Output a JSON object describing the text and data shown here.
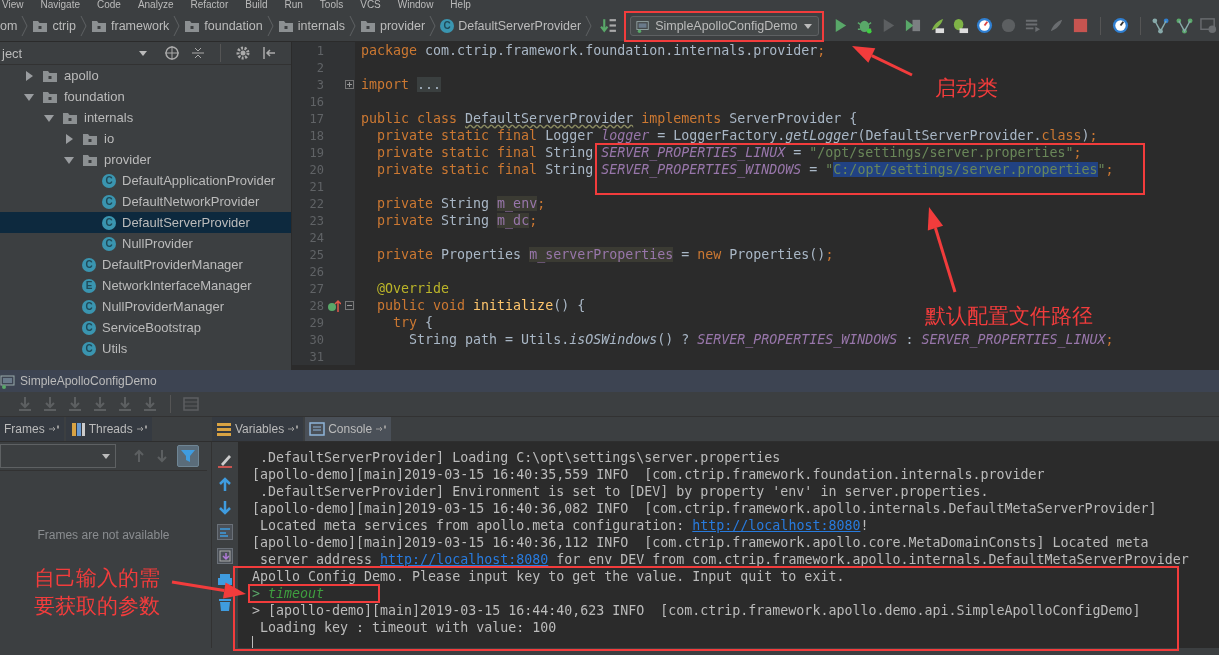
{
  "menu": [
    "View",
    "Navigate",
    "Code",
    "Analyze",
    "Refactor",
    "Build",
    "Run",
    "Tools",
    "VCS",
    "Window",
    "Help"
  ],
  "breadcrumbs": [
    {
      "text": "om",
      "kind": "fragment"
    },
    {
      "text": "ctrip",
      "kind": "folder"
    },
    {
      "text": "framework",
      "kind": "folder"
    },
    {
      "text": "foundation",
      "kind": "folder"
    },
    {
      "text": "internals",
      "kind": "folder"
    },
    {
      "text": "provider",
      "kind": "folder"
    },
    {
      "text": "DefaultServerProvider",
      "kind": "class",
      "badge": "C"
    }
  ],
  "run_config": {
    "label": "SimpleApolloConfigDemo"
  },
  "project_panel": {
    "title": "ject",
    "tree": [
      {
        "label": "apollo",
        "kind": "folder",
        "expanded": false,
        "selected": false
      },
      {
        "label": "foundation",
        "kind": "folder",
        "expanded": true,
        "selected": false,
        "children": [
          {
            "label": "internals",
            "kind": "folder",
            "expanded": true,
            "selected": false,
            "children": [
              {
                "label": "io",
                "kind": "folder",
                "expanded": false,
                "selected": false
              },
              {
                "label": "provider",
                "kind": "folder",
                "expanded": true,
                "selected": false,
                "children": [
                  {
                    "label": "DefaultApplicationProvider",
                    "kind": "class",
                    "badge": "C",
                    "selected": false
                  },
                  {
                    "label": "DefaultNetworkProvider",
                    "kind": "class",
                    "badge": "C",
                    "selected": false
                  },
                  {
                    "label": "DefaultServerProvider",
                    "kind": "class",
                    "badge": "C",
                    "selected": true
                  },
                  {
                    "label": "NullProvider",
                    "kind": "class",
                    "badge": "C",
                    "selected": false
                  }
                ]
              },
              {
                "label": "DefaultProviderManager",
                "kind": "class",
                "badge": "C",
                "selected": false
              },
              {
                "label": "NetworkInterfaceManager",
                "kind": "class",
                "badge": "E",
                "selected": false
              },
              {
                "label": "NullProviderManager",
                "kind": "class",
                "badge": "C",
                "selected": false
              },
              {
                "label": "ServiceBootstrap",
                "kind": "class",
                "badge": "C",
                "selected": false
              },
              {
                "label": "Utils",
                "kind": "class",
                "badge": "C",
                "selected": false
              }
            ]
          }
        ]
      }
    ]
  },
  "editor": {
    "lines": [
      {
        "number": "1",
        "segments": [
          {
            "text": "package",
            "kind": "kw"
          },
          {
            "text": " com.ctrip.framework.foundation.internals.provider",
            "kind": "plain"
          },
          {
            "text": ";",
            "kind": "kw"
          }
        ]
      },
      {
        "number": "2"
      },
      {
        "number": "3",
        "collapsed": true,
        "segments": [
          {
            "text": "import ",
            "kind": "kw"
          },
          {
            "text": "...",
            "kind": "folded"
          }
        ]
      },
      {
        "number": "16"
      },
      {
        "number": "17",
        "segments": [
          {
            "text": "public class ",
            "kind": "kw"
          },
          {
            "text": "DefaultServerProvider",
            "kind": "squiggle"
          },
          {
            "text": " implements ",
            "kind": "kw"
          },
          {
            "text": "ServerProvider {",
            "kind": "plain"
          }
        ]
      },
      {
        "number": "18",
        "segments": [
          {
            "text": "  private static final ",
            "kind": "kw"
          },
          {
            "text": "Logger ",
            "kind": "plain"
          },
          {
            "text": "logger",
            "kind": "const"
          },
          {
            "text": " = LoggerFactory.",
            "kind": "plain"
          },
          {
            "text": "getLogger",
            "kind": "static"
          },
          {
            "text": "(DefaultServerProvider.",
            "kind": "plain"
          },
          {
            "text": "class",
            "kind": "kw"
          },
          {
            "text": ")",
            "kind": "plain"
          },
          {
            "text": ";",
            "kind": "kw"
          }
        ]
      },
      {
        "number": "19",
        "segments": [
          {
            "text": "  private static final ",
            "kind": "kw"
          },
          {
            "text": "String ",
            "kind": "plain"
          },
          {
            "text": "SERVER_PROPERTIES_LINUX",
            "kind": "const"
          },
          {
            "text": " = ",
            "kind": "plain"
          },
          {
            "text": "\"/opt/settings/server.properties\"",
            "kind": "str"
          },
          {
            "text": ";",
            "kind": "kw"
          }
        ]
      },
      {
        "number": "20",
        "segments": [
          {
            "text": "  private static final ",
            "kind": "kw"
          },
          {
            "text": "String ",
            "kind": "plain"
          },
          {
            "text": "SERVER_PROPERTIES_WINDOWS",
            "kind": "const"
          },
          {
            "text": " = ",
            "kind": "plain"
          },
          {
            "text": "\"",
            "kind": "str"
          },
          {
            "text": "C:/opt/settings/server.properties",
            "kind": "selected"
          },
          {
            "text": "\"",
            "kind": "str"
          },
          {
            "text": ";",
            "kind": "kw"
          }
        ]
      },
      {
        "number": "21"
      },
      {
        "number": "22",
        "segments": [
          {
            "text": "  private ",
            "kind": "kw"
          },
          {
            "text": "String ",
            "kind": "plain"
          },
          {
            "text": "m_env",
            "kind": "field"
          },
          {
            "text": ";",
            "kind": "kw"
          }
        ]
      },
      {
        "number": "23",
        "segments": [
          {
            "text": "  private ",
            "kind": "kw"
          },
          {
            "text": "String ",
            "kind": "plain"
          },
          {
            "text": "m_dc",
            "kind": "field"
          },
          {
            "text": ";",
            "kind": "kw"
          }
        ]
      },
      {
        "number": "24"
      },
      {
        "number": "25",
        "segments": [
          {
            "text": "  private ",
            "kind": "kw"
          },
          {
            "text": "Properties ",
            "kind": "plain"
          },
          {
            "text": "m_serverProperties",
            "kind": "field"
          },
          {
            "text": " = ",
            "kind": "plain"
          },
          {
            "text": "new ",
            "kind": "kw"
          },
          {
            "text": "Properties()",
            "kind": "plain"
          },
          {
            "text": ";",
            "kind": "kw"
          }
        ]
      },
      {
        "number": "26"
      },
      {
        "number": "27",
        "segments": [
          {
            "text": "  @Override",
            "kind": "annotation"
          }
        ]
      },
      {
        "number": "28",
        "collapsed": false,
        "override": true,
        "segments": [
          {
            "text": "  public void ",
            "kind": "kw"
          },
          {
            "text": "initialize",
            "kind": "method"
          },
          {
            "text": "() {",
            "kind": "plain"
          }
        ]
      },
      {
        "number": "29",
        "segments": [
          {
            "text": "    try ",
            "kind": "kw"
          },
          {
            "text": "{",
            "kind": "plain"
          }
        ]
      },
      {
        "number": "30",
        "segments": [
          {
            "text": "      String path = Utils.",
            "kind": "plain"
          },
          {
            "text": "isOSWindows",
            "kind": "static"
          },
          {
            "text": "() ? ",
            "kind": "plain"
          },
          {
            "text": "SERVER_PROPERTIES_WINDOWS",
            "kind": "const"
          },
          {
            "text": " : ",
            "kind": "plain"
          },
          {
            "text": "SERVER_PROPERTIES_LINUX",
            "kind": "const"
          },
          {
            "text": ";",
            "kind": "kw"
          }
        ]
      },
      {
        "number": "31"
      }
    ]
  },
  "debug": {
    "title": "SimpleApolloConfigDemo",
    "tabs": [
      {
        "label": "Frames",
        "kind": "frames",
        "selected": false
      },
      {
        "label": "Threads",
        "kind": "threads",
        "selected": false
      },
      {
        "label": "Variables",
        "kind": "variables",
        "selected": false
      },
      {
        "label": "Console",
        "kind": "console",
        "selected": true
      }
    ],
    "frames_filter": {
      "on": true
    },
    "frames_message": "Frames are not available",
    "console": [
      {
        "segments": [
          {
            "text": " .DefaultServerProvider] Loading C:\\opt\\settings\\server.properties",
            "kind": "plain"
          }
        ]
      },
      {
        "segments": [
          {
            "text": "[apollo-demo][main]2019-03-15 16:40:35,559 INFO  [com.ctrip.framework.foundation.internals.provider",
            "kind": "plain"
          }
        ]
      },
      {
        "segments": [
          {
            "text": " .DefaultServerProvider] Environment is set to [DEV] by property 'env' in server.properties.",
            "kind": "plain"
          }
        ]
      },
      {
        "segments": [
          {
            "text": "[apollo-demo][main]2019-03-15 16:40:36,082 INFO  [com.ctrip.framework.apollo.internals.DefaultMetaServerProvider]",
            "kind": "plain"
          }
        ]
      },
      {
        "segments": [
          {
            "text": " Located meta services from apollo.meta configuration: ",
            "kind": "plain"
          },
          {
            "text": "http://localhost:8080",
            "kind": "link"
          },
          {
            "text": "!",
            "kind": "plain"
          }
        ]
      },
      {
        "segments": [
          {
            "text": "[apollo-demo][main]2019-03-15 16:40:36,112 INFO  [com.ctrip.framework.apollo.core.MetaDomainConsts] Located meta",
            "kind": "plain"
          }
        ]
      },
      {
        "segments": [
          {
            "text": " server address ",
            "kind": "plain"
          },
          {
            "text": "http://localhost:8080",
            "kind": "link"
          },
          {
            "text": " for env DEV from com.ctrip.framework.apollo.internals.DefaultMetaServerProvider",
            "kind": "plain"
          }
        ]
      },
      {
        "segments": [
          {
            "text": "Apollo Config Demo. Please input key to get the value. Input quit to exit.",
            "kind": "plain"
          }
        ]
      },
      {
        "segments": [
          {
            "text": "> ",
            "kind": "prompt"
          },
          {
            "text": "timeout",
            "kind": "input"
          }
        ]
      },
      {
        "segments": [
          {
            "text": "> [apollo-demo][main]2019-03-15 16:44:40,623 INFO  [com.ctrip.framework.apollo.demo.api.SimpleApolloConfigDemo]",
            "kind": "plain"
          }
        ]
      },
      {
        "segments": [
          {
            "text": " Loading key : timeout with value: 100",
            "kind": "plain"
          }
        ]
      }
    ]
  },
  "callouts": [
    {
      "text": "启动类"
    },
    {
      "text": "默认配置文件路径"
    },
    {
      "text": "自己输入的需要获取的参数"
    }
  ]
}
